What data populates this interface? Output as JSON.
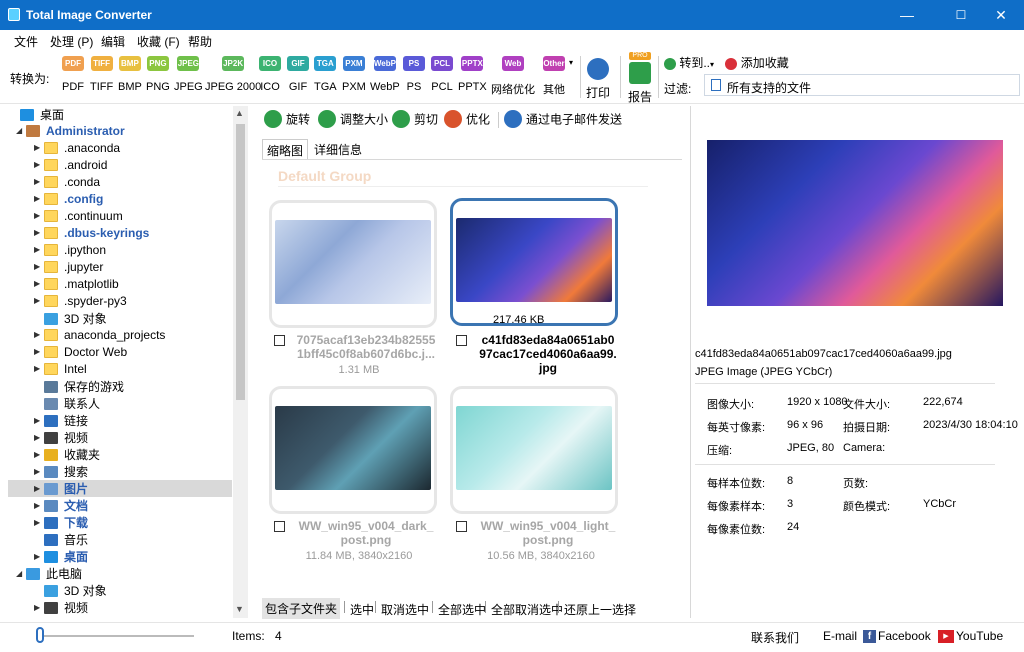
{
  "window": {
    "title": "Total Image Converter",
    "minimize": "—",
    "maximize": "☐",
    "close": "✕"
  },
  "menu": [
    "文件",
    "处理 (P)",
    "编辑",
    "收藏 (F)",
    "帮助"
  ],
  "toolbar": {
    "convert_label": "转换为:",
    "formats": [
      {
        "label": "PDF",
        "icon": "PDF",
        "color": "#f0a050"
      },
      {
        "label": "TIFF",
        "icon": "TIFF",
        "color": "#f0b040"
      },
      {
        "label": "BMP",
        "icon": "BMP",
        "color": "#e8c040"
      },
      {
        "label": "PNG",
        "icon": "PNG",
        "color": "#8cc63f"
      },
      {
        "label": "JPEG",
        "icon": "JPEG",
        "color": "#6fc04a"
      },
      {
        "label": "JPEG 2000",
        "icon": "JP2K",
        "color": "#5cb85c"
      },
      {
        "label": "ICO",
        "icon": "ICO",
        "color": "#3cb371"
      },
      {
        "label": "GIF",
        "icon": "GIF",
        "color": "#2eaaa0"
      },
      {
        "label": "TGA",
        "icon": "TGA",
        "color": "#2a9fd0"
      },
      {
        "label": "PXM",
        "icon": "PXM",
        "color": "#3a7fd5"
      },
      {
        "label": "WebP",
        "icon": "WebP",
        "color": "#4a6ad8"
      },
      {
        "label": "PS",
        "icon": "PS",
        "color": "#5a5ad8"
      },
      {
        "label": "PCL",
        "icon": "PCL",
        "color": "#7a4ad0"
      },
      {
        "label": "PPTX",
        "icon": "PPTX",
        "color": "#a040c8"
      },
      {
        "label": "网络优化",
        "icon": "Web",
        "color": "#b040c0"
      },
      {
        "label": "其他",
        "icon": "Other",
        "color": "#c040b0"
      }
    ],
    "print": "打印",
    "report": "报告",
    "pro_badge": "PRO",
    "goto": "转到..",
    "add_favorite": "添加收藏",
    "filter_label": "过滤:",
    "filter_value": "所有支持的文件"
  },
  "tree": {
    "items": [
      {
        "label": "桌面",
        "kind": "desktop",
        "arrow": "",
        "indent": 0,
        "style": "normal"
      },
      {
        "label": "Administrator",
        "kind": "user",
        "arrow": "◢",
        "indent": 1,
        "style": "bluebold"
      },
      {
        "label": ".anaconda",
        "kind": "folder",
        "arrow": "▶",
        "indent": 2,
        "style": "normal"
      },
      {
        "label": ".android",
        "kind": "folder",
        "arrow": "▶",
        "indent": 2,
        "style": "normal"
      },
      {
        "label": ".conda",
        "kind": "folder",
        "arrow": "▶",
        "indent": 2,
        "style": "normal"
      },
      {
        "label": ".config",
        "kind": "folder",
        "arrow": "▶",
        "indent": 2,
        "style": "bluebold"
      },
      {
        "label": ".continuum",
        "kind": "folder",
        "arrow": "▶",
        "indent": 2,
        "style": "normal"
      },
      {
        "label": ".dbus-keyrings",
        "kind": "folder",
        "arrow": "▶",
        "indent": 2,
        "style": "bluebold"
      },
      {
        "label": ".ipython",
        "kind": "folder",
        "arrow": "▶",
        "indent": 2,
        "style": "normal"
      },
      {
        "label": ".jupyter",
        "kind": "folder",
        "arrow": "▶",
        "indent": 2,
        "style": "normal"
      },
      {
        "label": ".matplotlib",
        "kind": "folder",
        "arrow": "▶",
        "indent": 2,
        "style": "normal"
      },
      {
        "label": ".spyder-py3",
        "kind": "folder",
        "arrow": "▶",
        "indent": 2,
        "style": "normal"
      },
      {
        "label": "3D 对象",
        "kind": "cube",
        "arrow": "",
        "indent": 2,
        "style": "normal"
      },
      {
        "label": "anaconda_projects",
        "kind": "folder",
        "arrow": "▶",
        "indent": 2,
        "style": "normal"
      },
      {
        "label": "Doctor Web",
        "kind": "folder",
        "arrow": "▶",
        "indent": 2,
        "style": "normal"
      },
      {
        "label": "Intel",
        "kind": "folder",
        "arrow": "▶",
        "indent": 2,
        "style": "normal"
      },
      {
        "label": "保存的游戏",
        "kind": "game",
        "arrow": "",
        "indent": 2,
        "style": "normal"
      },
      {
        "label": "联系人",
        "kind": "contacts",
        "arrow": "",
        "indent": 2,
        "style": "normal"
      },
      {
        "label": "链接",
        "kind": "link",
        "arrow": "▶",
        "indent": 2,
        "style": "normal"
      },
      {
        "label": "视频",
        "kind": "video",
        "arrow": "▶",
        "indent": 2,
        "style": "normal"
      },
      {
        "label": "收藏夹",
        "kind": "star",
        "arrow": "▶",
        "indent": 2,
        "style": "normal"
      },
      {
        "label": "搜索",
        "kind": "search",
        "arrow": "▶",
        "indent": 2,
        "style": "normal"
      },
      {
        "label": "图片",
        "kind": "pictures",
        "arrow": "▶",
        "indent": 2,
        "style": "bluebold",
        "selected": true
      },
      {
        "label": "文档",
        "kind": "docs",
        "arrow": "▶",
        "indent": 2,
        "style": "bluebold"
      },
      {
        "label": "下载",
        "kind": "download",
        "arrow": "▶",
        "indent": 2,
        "style": "bluebold"
      },
      {
        "label": "音乐",
        "kind": "music",
        "arrow": "",
        "indent": 2,
        "style": "normal"
      },
      {
        "label": "桌面",
        "kind": "desktop",
        "arrow": "▶",
        "indent": 2,
        "style": "bluebold"
      },
      {
        "label": "此电脑",
        "kind": "pc",
        "arrow": "◢",
        "indent": 1,
        "style": "normal"
      },
      {
        "label": "3D 对象",
        "kind": "cube",
        "arrow": "",
        "indent": 2,
        "style": "normal"
      },
      {
        "label": "视频",
        "kind": "video",
        "arrow": "▶",
        "indent": 2,
        "style": "normal"
      }
    ]
  },
  "actions": [
    {
      "label": "旋转",
      "color": "#2e9e4a"
    },
    {
      "label": "调整大小",
      "color": "#2e9e4a"
    },
    {
      "label": "剪切",
      "color": "#2e9e4a"
    },
    {
      "label": "优化",
      "color": "#d9532c"
    },
    {
      "label": "通过电子邮件发送",
      "color": "#2d6fbf"
    }
  ],
  "tabs": [
    "缩略图",
    "详细信息"
  ],
  "group_title": "Default Group",
  "thumbnails": [
    {
      "name": "7075acaf13eb234b82555 1bff45c0f8ab607d6bc.j...",
      "meta": "1.31 MB",
      "selected": false
    },
    {
      "name": "c41fd83eda84a0651ab0 97cac17ced4060a6aa99. jpg",
      "meta": "",
      "badge": "217.46 KB",
      "selected": true
    },
    {
      "name": "WW_win95_v004_dark_ post.png",
      "meta": "11.84 MB, 3840x2160",
      "selected": false
    },
    {
      "name": "WW_win95_v004_light_ post.png",
      "meta": "10.56 MB, 3840x2160",
      "selected": false
    }
  ],
  "bottom_links": [
    "包含子文件夹",
    "选中",
    "取消选中",
    "全部选中",
    "全部取消选中",
    "还原上一选择"
  ],
  "details": {
    "filename": "c41fd83eda84a0651ab097cac17ced4060a6aa99.jpg",
    "filetype": "JPEG Image (JPEG YCbCr)",
    "props": [
      {
        "k": "图像大小:",
        "v": "1920 x 1080"
      },
      {
        "k": "文件大小:",
        "v": "222,674"
      },
      {
        "k": "每英寸像素:",
        "v": "96 x 96"
      },
      {
        "k": "拍摄日期:",
        "v": "2023/4/30 18:04:10"
      },
      {
        "k": "压缩:",
        "v": "JPEG, 80"
      },
      {
        "k": "Camera:",
        "v": ""
      },
      {
        "k": "每样本位数:",
        "v": "8"
      },
      {
        "k": "页数:",
        "v": ""
      },
      {
        "k": "每像素样本:",
        "v": "3"
      },
      {
        "k": "颜色模式:",
        "v": "YCbCr"
      },
      {
        "k": "每像素位数:",
        "v": "24"
      }
    ]
  },
  "status": {
    "items_label": "Items:",
    "items_count": "4",
    "contact": "联系我们",
    "email": "E-mail",
    "facebook": "Facebook",
    "youtube": "YouTube"
  }
}
